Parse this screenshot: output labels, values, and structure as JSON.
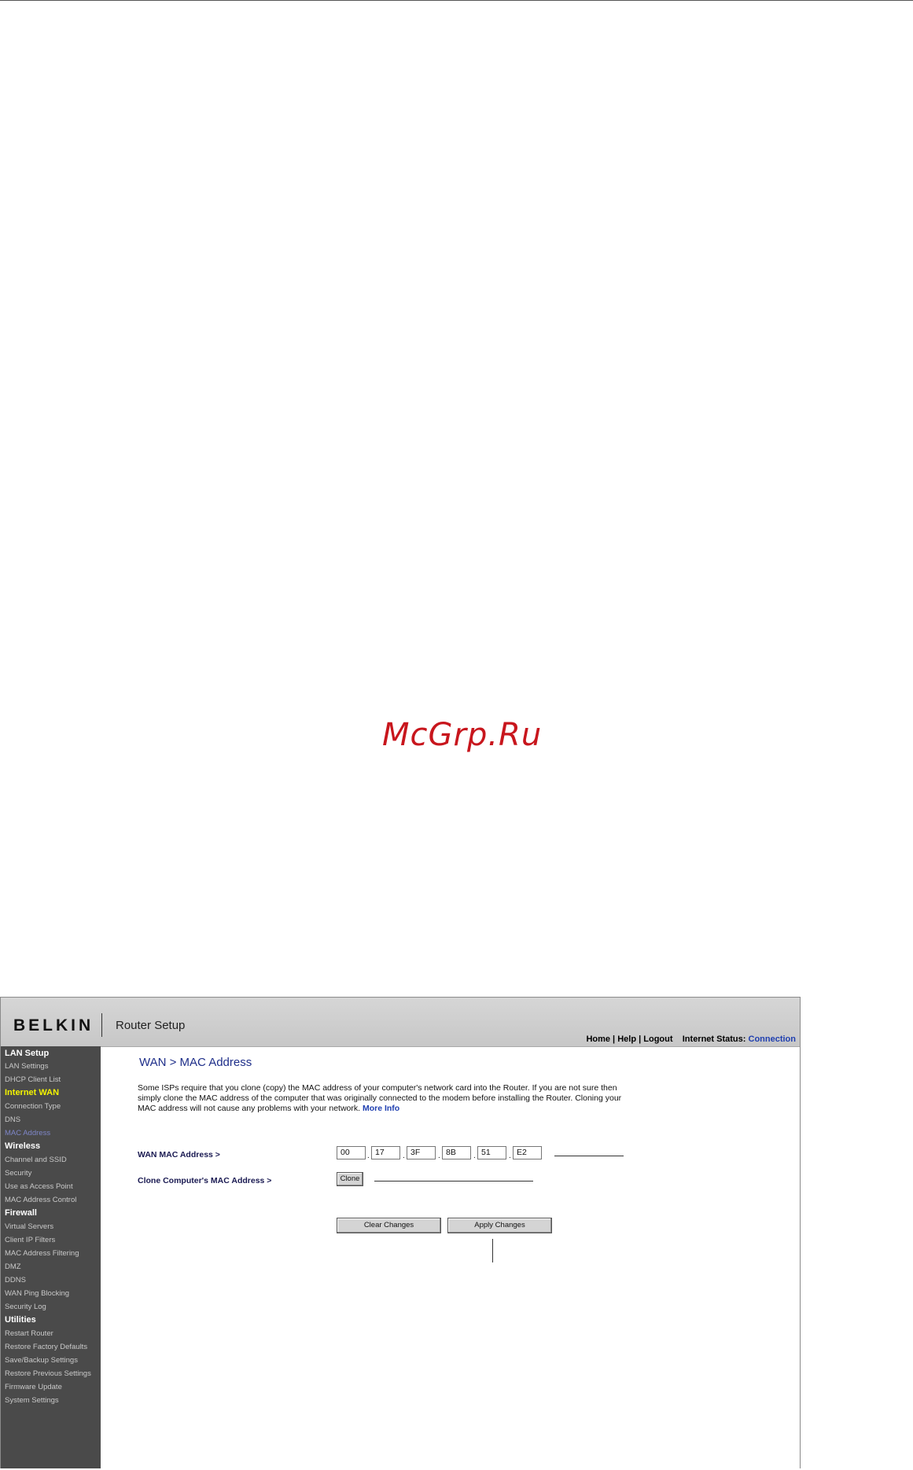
{
  "watermark": "McGrp.Ru",
  "header": {
    "logo": "BELKIN",
    "app_title": "Router Setup",
    "links": {
      "home": "Home",
      "help": "Help",
      "logout": "Logout",
      "sep": " | ",
      "status_label": "Internet Status:",
      "status_value": "Connection"
    }
  },
  "sidebar": {
    "groups": [
      {
        "title": "LAN Setup",
        "items": [
          "LAN Settings",
          "DHCP Client List"
        ]
      },
      {
        "title": "Internet WAN",
        "items": [
          "Connection Type",
          "DNS",
          "MAC Address"
        ]
      },
      {
        "title": "Wireless",
        "items": [
          "Channel and SSID",
          "Security",
          "Use as Access Point",
          "MAC Address Control"
        ]
      },
      {
        "title": "Firewall",
        "items": [
          "Virtual Servers",
          "Client IP Filters",
          "MAC Address Filtering",
          "DMZ",
          "DDNS",
          "WAN Ping Blocking",
          "Security Log"
        ]
      },
      {
        "title": "Utilities",
        "items": [
          "Restart Router",
          "Restore Factory Defaults",
          "Save/Backup Settings",
          "Restore Previous Settings",
          "Firmware Update",
          "System Settings"
        ]
      }
    ]
  },
  "main": {
    "title": "WAN > MAC Address",
    "description": "Some ISPs require that you clone (copy) the MAC address of your computer's network card into the Router. If you are not sure then simply clone the MAC address of the computer that was originally connected to the modem before installing the Router. Cloning your MAC address will not cause any problems with your network.",
    "more_info": "More Info",
    "wan_mac_label": "WAN MAC Address >",
    "mac": [
      "00",
      "17",
      "3F",
      "8B",
      "51",
      "E2"
    ],
    "clone_label": "Clone Computer's MAC Address >",
    "clone_button": "Clone",
    "clear_button": "Clear Changes",
    "apply_button": "Apply Changes"
  }
}
